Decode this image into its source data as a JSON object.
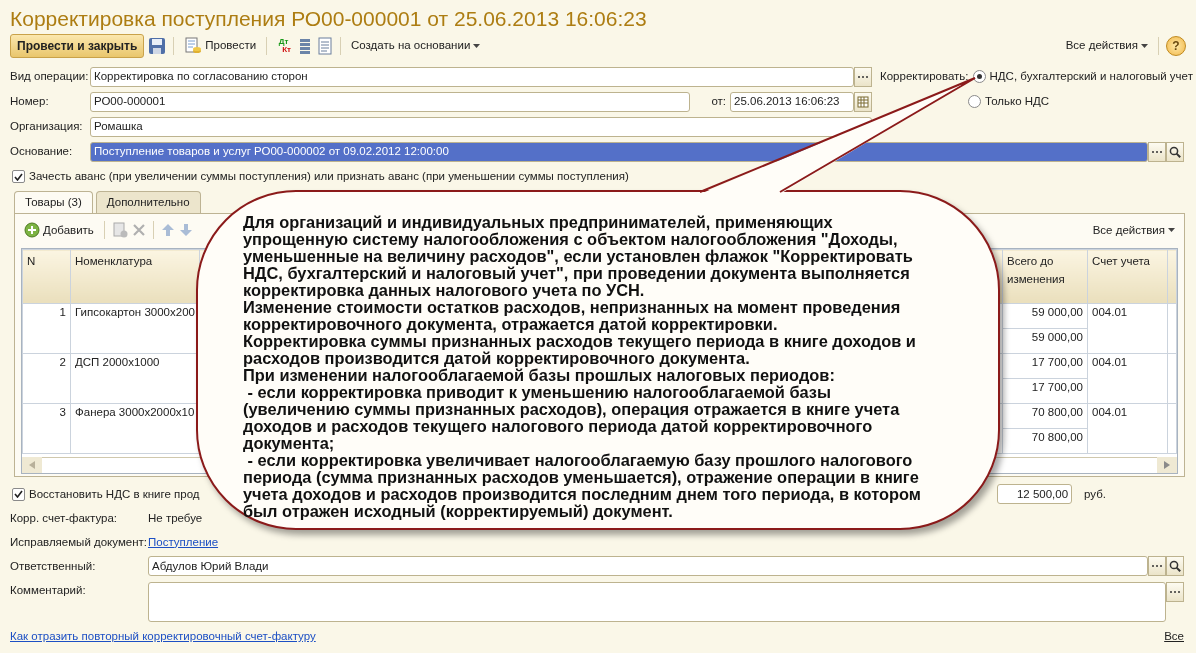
{
  "window": {
    "title": "Корректировка поступления РО00-000001 от 25.06.2013 16:06:23"
  },
  "toolbar": {
    "primary": "Провести и закрыть",
    "post": "Провести",
    "debit": "Дт",
    "credit": "Кт",
    "create_based": "Создать на основании",
    "all_actions": "Все действия",
    "help": "?"
  },
  "form": {
    "operation": {
      "label": "Вид операции:",
      "value": "Корректировка по согласованию сторон"
    },
    "number": {
      "label": "Номер:",
      "value": "РО00-000001",
      "date_label": "от:",
      "date": "25.06.2013 16:06:23"
    },
    "organization": {
      "label": "Организация:",
      "value": "Ромашка"
    },
    "basis": {
      "label": "Основание:",
      "value": "Поступление товаров и услуг РО00-000002 от 09.02.2012 12:00:00",
      "selected": true
    },
    "correct": {
      "label": "Корректировать:",
      "options": [
        {
          "label": "НДС, бухгалтерский и налоговый учет",
          "selected": true
        },
        {
          "label": "Только НДС",
          "selected": false
        }
      ]
    },
    "advance": {
      "label": "Зачесть аванс (при увеличении суммы поступления) или признать аванс (при уменьшении суммы поступления)",
      "checked": true
    }
  },
  "tabs": [
    {
      "label": "Товары (3)",
      "selected": true
    },
    {
      "label": "Дополнительно",
      "selected": false
    }
  ],
  "table_toolbar": {
    "add": "Добавить",
    "all_actions": "Все действия"
  },
  "table": {
    "columns": [
      "N",
      "Номенклатура",
      "Всего до изменения",
      "Счет учета"
    ],
    "rows": [
      {
        "n": "1",
        "item": "Гипсокартон 3000x200",
        "total_before": "59 000,00",
        "total": "59 000,00",
        "account": "004.01"
      },
      {
        "n": "2",
        "item": "ДСП 2000x1000",
        "total_before": "17 700,00",
        "total": "17 700,00",
        "account": "004.01"
      },
      {
        "n": "3",
        "item": "Фанера 3000x2000x10",
        "total_before": "70 800,00",
        "total": "70 800,00",
        "account": "004.01"
      }
    ]
  },
  "bottom": {
    "restore": {
      "label": "Восстановить НДС в книге прод",
      "checked": true
    },
    "amount": "12 500,00",
    "currency": "руб.",
    "corr_invoice": {
      "label": "Корр. счет-фактура:",
      "value": "Не требуе"
    },
    "corrected_doc": {
      "label": "Исправляемый документ:",
      "link": "Поступление"
    },
    "responsible": {
      "label": "Ответственный:",
      "value": "Абдулов Юрий Влади"
    },
    "comment": {
      "label": "Комментарий:"
    }
  },
  "footer": {
    "help_link": "Как отразить повторный корректировочный счет-фактуру",
    "all": "Все"
  },
  "callout": {
    "paragraphs": [
      "Для организаций и индивидуальных предпринимателей, применяющих упрощенную систему налогообложения с объектом налогообложения \"Доходы, уменьшенные на величину расходов\", если установлен флажок \"Корректировать НДС, бухгалтерский и налоговый учет\", при проведении документа выполняется корректировка данных налогового учета по УСН.",
      "Изменение стоимости остатков расходов, непризнанных на момент проведения корректировочного документа, отражается датой корректировки.",
      "Корректировка суммы признанных расходов текущего периода в книге доходов и расходов производится датой корректировочного документа.",
      "При изменении налогооблагаемой базы прошлых налоговых периодов:",
      " - если корректировка приводит к уменьшению налогооблагаемой базы (увеличению суммы признанных расходов), операция отражается в книге учета доходов и расходов текущего налогового периода датой корректировочного документа;",
      " - если корректировка увеличивает налогооблагаемую базу прошлого налогового периода (сумма признанных расходов уменьшается), отражение операции в книге учета доходов и расходов производится последним днем того периода, в котором был отражен исходный (корректируемый) документ."
    ]
  }
}
